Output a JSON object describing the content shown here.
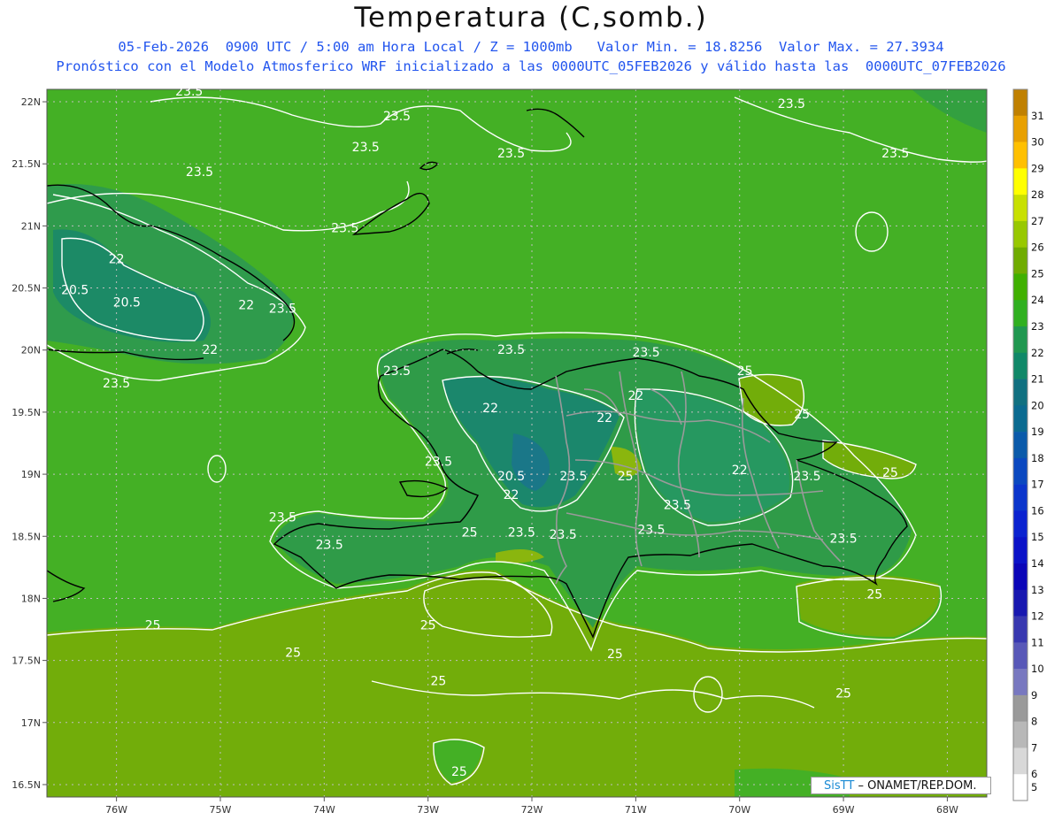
{
  "title": "Temperatura (C,somb.)",
  "subtitle_line1": "05-Feb-2026  0900 UTC / 5:00 am Hora Local / Z = 1000mb   Valor Min. = 18.8256  Valor Max. = 27.3934",
  "subtitle_line2": "Pronóstico con el Modelo Atmosferico WRF inicializado a las 0000UTC_05FEB2026 y válido hasta las  0000UTC_07FEB2026",
  "credit": {
    "brand": "SisTT",
    "text": "– ONAMET/REP.DOM."
  },
  "map": {
    "lat_labels": [
      "22N",
      "21.5N",
      "21N",
      "20.5N",
      "20N",
      "19.5N",
      "19N",
      "18.5N",
      "18N",
      "17.5N",
      "17N",
      "16.5N"
    ],
    "lat_values": [
      22,
      21.5,
      21,
      20.5,
      20,
      19.5,
      19,
      18.5,
      18,
      17.5,
      17,
      16.5
    ],
    "lon_labels": [
      "76W",
      "75W",
      "74W",
      "73W",
      "72W",
      "71W",
      "70W",
      "69W",
      "68W"
    ],
    "lon_values": [
      -76,
      -75,
      -74,
      -73,
      -72,
      -71,
      -70,
      -69,
      -68
    ],
    "lat_range": [
      16.4,
      22.1
    ],
    "lon_range": [
      -76.67,
      -67.62
    ],
    "contour_labels": [
      {
        "text": "23.5",
        "lon": -75.3,
        "lat": 22.05
      },
      {
        "text": "23.5",
        "lon": -73.3,
        "lat": 21.85
      },
      {
        "text": "23.5",
        "lon": -73.6,
        "lat": 21.6
      },
      {
        "text": "23.5",
        "lon": -72.2,
        "lat": 21.55
      },
      {
        "text": "23.5",
        "lon": -75.2,
        "lat": 21.4
      },
      {
        "text": "23.5",
        "lon": -73.8,
        "lat": 20.95
      },
      {
        "text": "23.5",
        "lon": -69.5,
        "lat": 21.95
      },
      {
        "text": "23.5",
        "lon": -68.5,
        "lat": 21.55
      },
      {
        "text": "22",
        "lon": -76.0,
        "lat": 20.7
      },
      {
        "text": "20.5",
        "lon": -76.4,
        "lat": 20.45
      },
      {
        "text": "20.5",
        "lon": -75.9,
        "lat": 20.35
      },
      {
        "text": "22",
        "lon": -74.75,
        "lat": 20.33
      },
      {
        "text": "23.5",
        "lon": -74.4,
        "lat": 20.3
      },
      {
        "text": "22",
        "lon": -75.1,
        "lat": 19.97
      },
      {
        "text": "23.5",
        "lon": -76.0,
        "lat": 19.7
      },
      {
        "text": "23.5",
        "lon": -73.3,
        "lat": 19.8
      },
      {
        "text": "23.5",
        "lon": -72.2,
        "lat": 19.97
      },
      {
        "text": "23.5",
        "lon": -70.9,
        "lat": 19.95
      },
      {
        "text": "25",
        "lon": -69.95,
        "lat": 19.8
      },
      {
        "text": "22",
        "lon": -72.4,
        "lat": 19.5
      },
      {
        "text": "22",
        "lon": -71.0,
        "lat": 19.6
      },
      {
        "text": "22",
        "lon": -71.3,
        "lat": 19.42
      },
      {
        "text": "25",
        "lon": -69.4,
        "lat": 19.45
      },
      {
        "text": "23.5",
        "lon": -72.9,
        "lat": 19.07
      },
      {
        "text": "20.5",
        "lon": -72.2,
        "lat": 18.95
      },
      {
        "text": "23.5",
        "lon": -71.6,
        "lat": 18.95
      },
      {
        "text": "25",
        "lon": -71.1,
        "lat": 18.95
      },
      {
        "text": "22",
        "lon": -70.0,
        "lat": 19.0
      },
      {
        "text": "23.5",
        "lon": -69.35,
        "lat": 18.95
      },
      {
        "text": "25",
        "lon": -68.55,
        "lat": 18.98
      },
      {
        "text": "22",
        "lon": -72.2,
        "lat": 18.8
      },
      {
        "text": "23.5",
        "lon": -70.6,
        "lat": 18.72
      },
      {
        "text": "23.5",
        "lon": -74.4,
        "lat": 18.62
      },
      {
        "text": "23.5",
        "lon": -72.1,
        "lat": 18.5
      },
      {
        "text": "25",
        "lon": -72.6,
        "lat": 18.5
      },
      {
        "text": "23.5",
        "lon": -71.7,
        "lat": 18.48
      },
      {
        "text": "23.5",
        "lon": -70.85,
        "lat": 18.52
      },
      {
        "text": "23.5",
        "lon": -69.0,
        "lat": 18.45
      },
      {
        "text": "23.5",
        "lon": -73.95,
        "lat": 18.4
      },
      {
        "text": "25",
        "lon": -68.7,
        "lat": 18.0
      },
      {
        "text": "25",
        "lon": -75.65,
        "lat": 17.75
      },
      {
        "text": "25",
        "lon": -74.3,
        "lat": 17.53
      },
      {
        "text": "25",
        "lon": -73.0,
        "lat": 17.75
      },
      {
        "text": "25",
        "lon": -71.2,
        "lat": 17.52
      },
      {
        "text": "25",
        "lon": -72.9,
        "lat": 17.3
      },
      {
        "text": "25",
        "lon": -69.0,
        "lat": 17.2
      },
      {
        "text": "25",
        "lon": -72.7,
        "lat": 16.57
      }
    ]
  },
  "colorbar": {
    "labels": [
      "31",
      "30",
      "29",
      "28",
      "27",
      "26",
      "25",
      "24",
      "23",
      "22",
      "21",
      "20",
      "19",
      "18",
      "17",
      "16",
      "15",
      "14",
      "13",
      "12",
      "11",
      "10",
      "9",
      "8",
      "7",
      "6",
      "5"
    ],
    "colors": [
      "#c08000",
      "#e8a000",
      "#ffc000",
      "#ffff00",
      "#c8e000",
      "#98c800",
      "#70ac00",
      "#40b000",
      "#30b020",
      "#209850",
      "#108868",
      "#107080",
      "#0a6a90",
      "#0a5aaa",
      "#0a48c0",
      "#0a35cc",
      "#0a22d0",
      "#0a12c8",
      "#0a05b8",
      "#1818b0",
      "#3838b0",
      "#5858b8",
      "#7878c0",
      "#9a9a9a",
      "#b8b8b8",
      "#d8d8d8",
      "#ffffff"
    ]
  }
}
